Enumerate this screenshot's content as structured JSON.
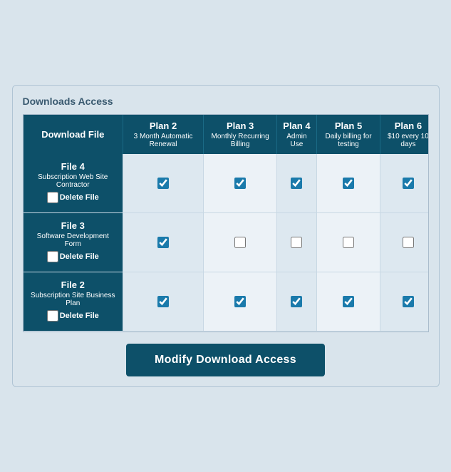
{
  "title": "Downloads Access",
  "header": {
    "first_col": "Download File",
    "plans": [
      {
        "id": "plan2",
        "name": "Plan 2",
        "sub": "3 Month Automatic Renewal"
      },
      {
        "id": "plan3",
        "name": "Plan 3",
        "sub": "Monthly Recurring Billing"
      },
      {
        "id": "plan4",
        "name": "Plan 4",
        "sub": "Admin Use"
      },
      {
        "id": "plan5",
        "name": "Plan 5",
        "sub": "Daily billing for testing"
      },
      {
        "id": "plan6",
        "name": "Plan 6",
        "sub": "$10 every 10 days"
      }
    ]
  },
  "rows": [
    {
      "file_name": "File 4",
      "file_sub": "Subscription Web Site Contractor",
      "delete_label": "Delete File",
      "checks": [
        true,
        true,
        true,
        true,
        true
      ]
    },
    {
      "file_name": "File 3",
      "file_sub": "Software Development Form",
      "delete_label": "Delete File",
      "checks": [
        true,
        false,
        false,
        false,
        false
      ]
    },
    {
      "file_name": "File 2",
      "file_sub": "Subscription Site Business Plan",
      "delete_label": "Delete File",
      "checks": [
        true,
        true,
        true,
        true,
        true
      ]
    }
  ],
  "button_label": "Modify Download Access"
}
